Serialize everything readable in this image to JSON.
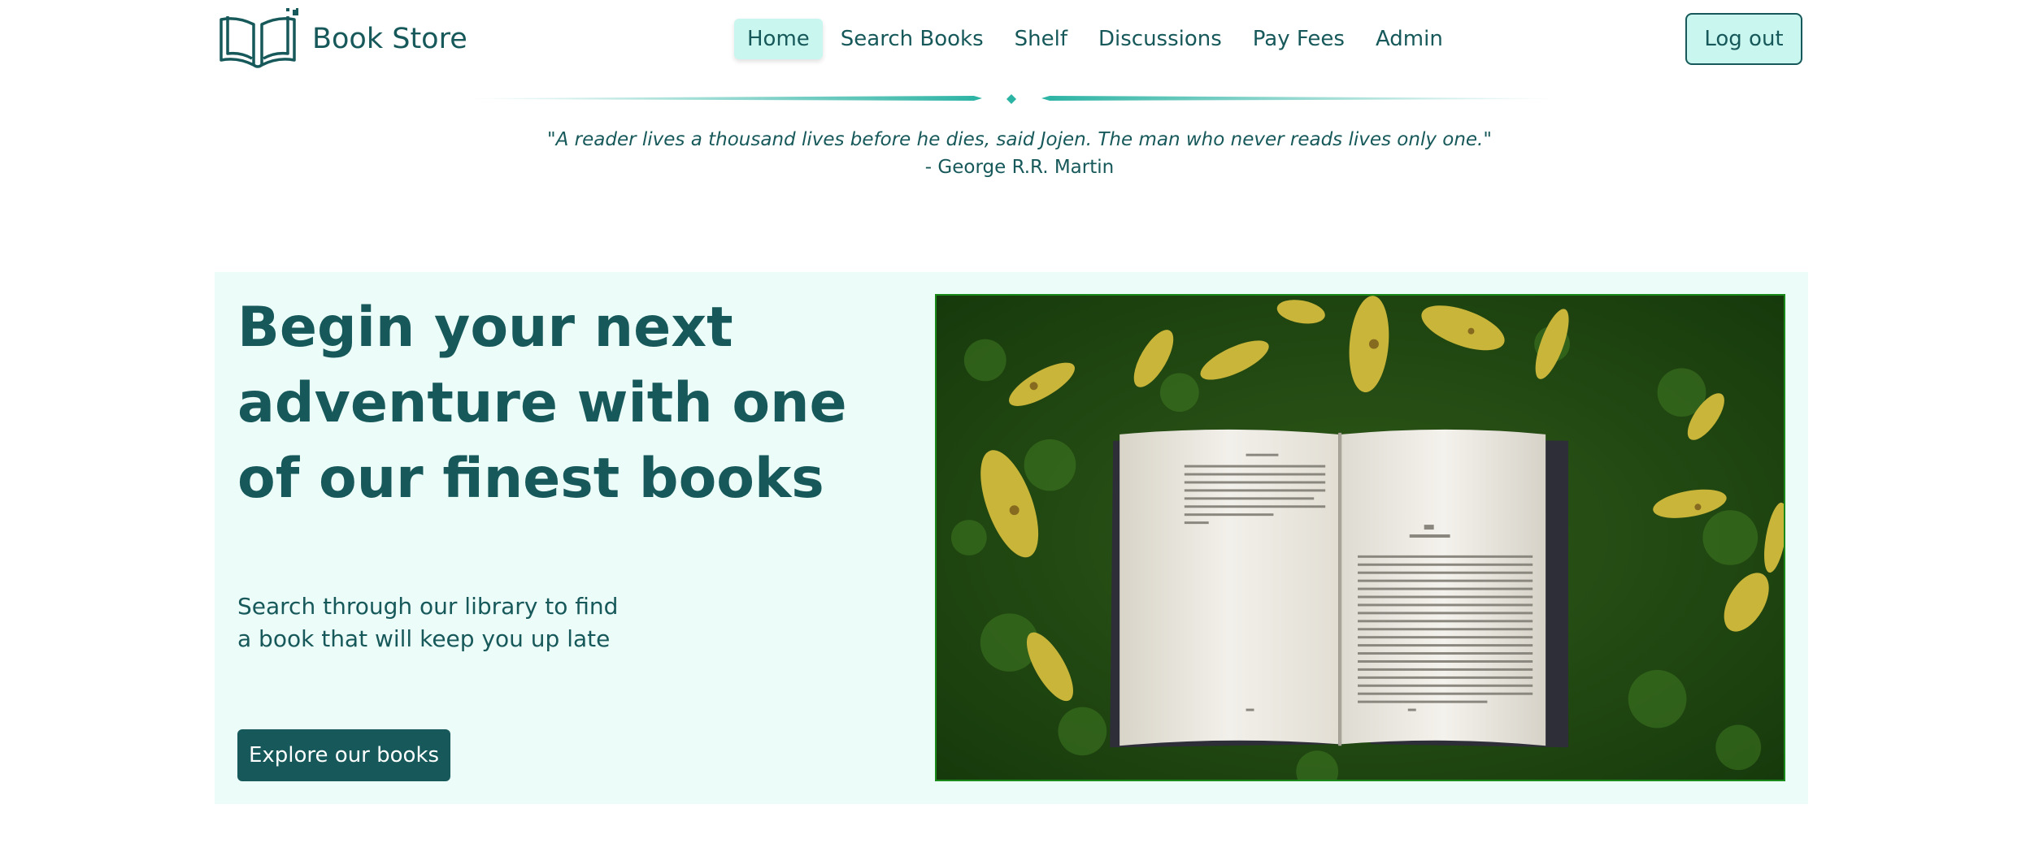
{
  "brand": {
    "name": "Book Store",
    "logo_icon": "open-book-logo-icon"
  },
  "nav": {
    "items": [
      {
        "label": "Home",
        "active": true
      },
      {
        "label": "Search Books",
        "active": false
      },
      {
        "label": "Shelf",
        "active": false
      },
      {
        "label": "Discussions",
        "active": false
      },
      {
        "label": "Pay Fees",
        "active": false
      },
      {
        "label": "Admin",
        "active": false
      }
    ]
  },
  "auth": {
    "logout_label": "Log out"
  },
  "quote": {
    "text": "\"A reader lives a thousand lives before he dies, said Jojen. The man who never reads lives only one.\"",
    "author": "- George R.R. Martin"
  },
  "hero": {
    "title": "Begin your next adventure with one of our finest books",
    "subtitle": "Search through our library to find a book that will keep you up late",
    "cta_label": "Explore our books",
    "image_icon": "open-book-on-grass-photo"
  },
  "colors": {
    "primary": "#17595a",
    "accent_light": "#c9f6ef",
    "hero_background": "#ecfcf9",
    "divider_teal": "#2bb3a3"
  }
}
